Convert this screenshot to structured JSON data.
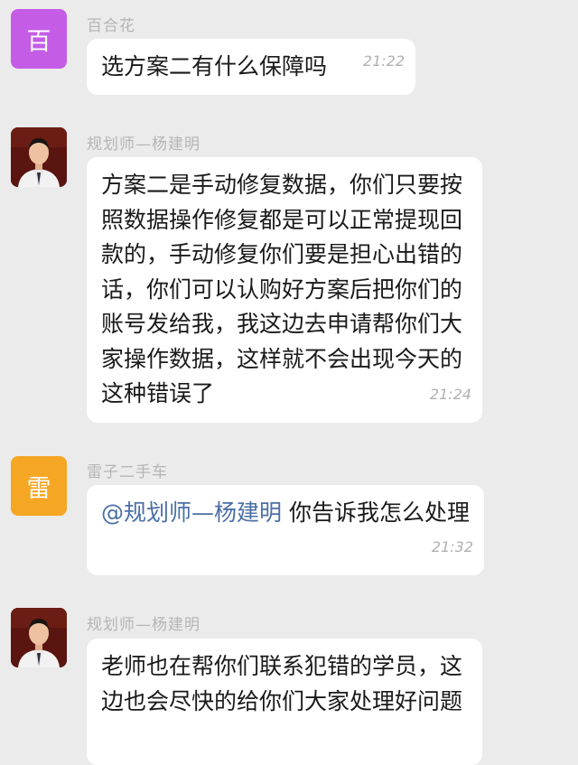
{
  "messages": [
    {
      "sender": "百合花",
      "avatar_char": "百",
      "avatar_color": "#c45ce6",
      "text": "选方案二有什么保障吗",
      "time": "21:22"
    },
    {
      "sender": "规划师—杨建明",
      "avatar_photo": true,
      "text": "方案二是手动修复数据，你们只要按照数据操作修复都是可以正常提现回款的，手动修复你们要是担心出错的话，你们可以认购好方案后把你们的账号发给我，我这边去申请帮你们大家操作数据，这样就不会出现今天的这种错误了",
      "time": "21:24"
    },
    {
      "sender": "雷子二手车",
      "avatar_char": "雷",
      "avatar_color": "#f5a623",
      "mention": "@规划师—杨建明",
      "text": " 你告诉我怎么处理",
      "time": "21:32"
    },
    {
      "sender": "规划师—杨建明",
      "avatar_photo": true,
      "text": "老师也在帮你们联系犯错的学员，这边也会尽快的给你们大家处理好问题"
    }
  ]
}
